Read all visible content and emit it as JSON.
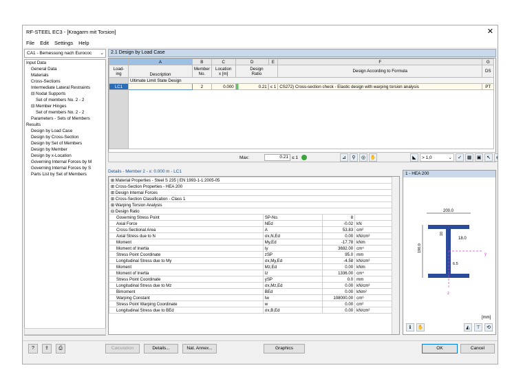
{
  "window": {
    "title": "RF-STEEL EC3 - [Kragarm mit Torsion]",
    "close": "✕"
  },
  "menu": [
    "File",
    "Edit",
    "Settings",
    "Help"
  ],
  "case_combo": "CA1 - Bemessung nach Eurococ",
  "nav": [
    {
      "label": "Input Data",
      "indent": 0
    },
    {
      "label": "General Data",
      "indent": 1
    },
    {
      "label": "Materials",
      "indent": 1
    },
    {
      "label": "Cross-Sections",
      "indent": 1
    },
    {
      "label": "Intermediate Lateral Restraints",
      "indent": 1
    },
    {
      "label": "⊟ Nodal Supports",
      "indent": 1
    },
    {
      "label": "Set of members No. 2 - 2",
      "indent": 2
    },
    {
      "label": "⊟ Member Hinges",
      "indent": 1
    },
    {
      "label": "Set of members No. 2 - 2",
      "indent": 2
    },
    {
      "label": "Parameters - Sets of Members",
      "indent": 1
    },
    {
      "label": "Results",
      "indent": 0
    },
    {
      "label": "Design by Load Case",
      "indent": 1
    },
    {
      "label": "Design by Cross-Section",
      "indent": 1
    },
    {
      "label": "Design by Set of Members",
      "indent": 1
    },
    {
      "label": "Design by Member",
      "indent": 1
    },
    {
      "label": "Design by x-Location",
      "indent": 1
    },
    {
      "label": "Governing Internal Forces by M",
      "indent": 1
    },
    {
      "label": "Governing Internal Forces by S",
      "indent": 1
    },
    {
      "label": "Parts List by Set of Members",
      "indent": 1
    }
  ],
  "section_title": "2.1 Design by Load Case",
  "grid": {
    "letters": [
      "A",
      "B",
      "C",
      "D",
      "E",
      "F",
      "G"
    ],
    "headers": {
      "loading": "Load-\ning",
      "desc": "Description",
      "member": "Member\nNo.",
      "location": "Location\nx [m]",
      "ratio": "Design\nRatio",
      "formula": "Design According to Formula",
      "ds": "DS"
    },
    "group_label": "Ultimate Limit State Design",
    "row": {
      "lc": "LC1",
      "member": "2",
      "location": "0.000",
      "ratio": "0.21",
      "le": "≤ 1",
      "formula": "CS272) Cross-section check - Elastic design with warping torsion analysis",
      "ds": "PT"
    },
    "max_label": "Max:",
    "max_value": "0.21",
    "max_le": "≤ 1",
    "filter": "> 1,0"
  },
  "details": {
    "title": "Details - Member 2 - x: 0.000 m - LC1",
    "groups": [
      "⊞ Material Properties - Steel S 235 | EN 1993-1-1:2005-05",
      "⊞ Cross-Section Properties  -  HEA 200",
      "⊞ Design Internal Forces",
      "⊞ Cross-Section Classification - Class 1",
      "⊞ Warping Torsion Analysis",
      "⊟ Design Ratio"
    ],
    "rows": [
      {
        "name": "Governing Stress Point",
        "sym": "SP-No.",
        "val": "8",
        "unit": ""
      },
      {
        "name": "Axial Force",
        "sym": "NEd",
        "val": "-0.02",
        "unit": "kN"
      },
      {
        "name": "Cross-Sectional Area",
        "sym": "A",
        "val": "53.83",
        "unit": "cm²"
      },
      {
        "name": "Axial Stress due to N",
        "sym": "σx,N,Ed",
        "val": "0.00",
        "unit": "kN/cm²"
      },
      {
        "name": "Moment",
        "sym": "My,Ed",
        "val": "-17.78",
        "unit": "kNm"
      },
      {
        "name": "Moment of Inertia",
        "sym": "Iy",
        "val": "3692.00",
        "unit": "cm⁴"
      },
      {
        "name": "Stress Point Coordinate",
        "sym": "zSP",
        "val": "95.0",
        "unit": "mm"
      },
      {
        "name": "Longitudinal Stress due to My",
        "sym": "σx,My,Ed",
        "val": "-4.58",
        "unit": "kN/cm²"
      },
      {
        "name": "Moment",
        "sym": "Mz,Ed",
        "val": "0.00",
        "unit": "kNm"
      },
      {
        "name": "Moment of Inertia",
        "sym": "Iz",
        "val": "1336.00",
        "unit": "cm⁴"
      },
      {
        "name": "Stress Point Coordinate",
        "sym": "ySP",
        "val": "0.0",
        "unit": "mm"
      },
      {
        "name": "Longitudinal Stress due to Mz",
        "sym": "σx,Mz,Ed",
        "val": "0.00",
        "unit": "kN/cm²"
      },
      {
        "name": "Bimoment",
        "sym": "BEd",
        "val": "0.00",
        "unit": "kNm²"
      },
      {
        "name": "Warping Constant",
        "sym": "Iw",
        "val": "108000.00",
        "unit": "cm⁶"
      },
      {
        "name": "Stress Point Warping Coordinate",
        "sym": "w",
        "val": "0.00",
        "unit": "cm²"
      },
      {
        "name": "Longitudinal Stress due to BEd",
        "sym": "σx,B,Ed",
        "val": "0.00",
        "unit": "kN/cm²"
      }
    ]
  },
  "cross_section": {
    "title": "1 - HEA 200",
    "width": "200.0",
    "flange": "10",
    "web": "18.0",
    "height": "190.0",
    "radius": "6.5",
    "y": "y",
    "z": "z",
    "unit": "[mm]"
  },
  "buttons": {
    "calculation": "Calculation",
    "details": "Details...",
    "nat_annex": "Nat. Annex...",
    "graphics": "Graphics",
    "ok": "OK",
    "cancel": "Cancel"
  }
}
